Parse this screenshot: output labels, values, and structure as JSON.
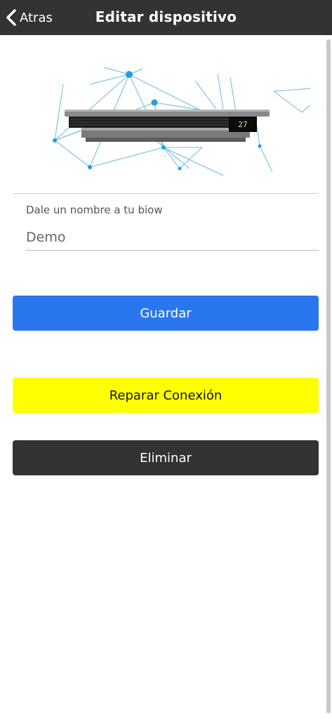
{
  "header": {
    "back_label": "Atras",
    "title": "Editar dispositivo"
  },
  "device": {
    "display_value": "27"
  },
  "form": {
    "name_label": "Dale un nombre a tu biow",
    "name_value": "Demo"
  },
  "buttons": {
    "save": "Guardar",
    "repair": "Reparar Conexión",
    "delete": "Eliminar"
  },
  "colors": {
    "header_bg": "#333333",
    "save_bg": "#2a76ee",
    "repair_bg": "#ffff00",
    "delete_bg": "#333333"
  }
}
